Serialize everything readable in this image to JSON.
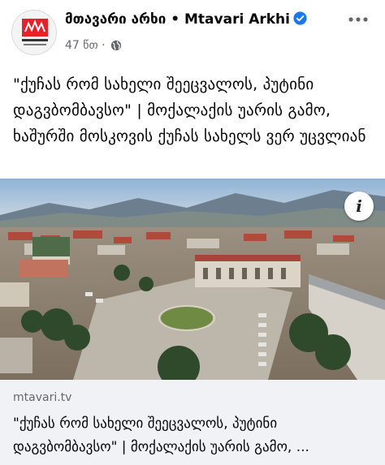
{
  "post": {
    "page_name": "მთავარი არხი • Mtavari Arkhi",
    "time": "47 წთ ·",
    "audience_icon": "globe-icon",
    "text": "\"ქუჩას რომ სახელი შეეცვალოს, პუტინი დაგვბომბავსო\" | მოქალაქის უარის გამო, ხაშურში მოსკოვის ქუჩას სახელს ვერ უცვლიან"
  },
  "link_preview": {
    "domain": "mtavari.tv",
    "title": "\"ქუჩას რომ სახელი შეეცვალოს, პუტინი დაგვბომბავსო\" | მოქალაქის უარის გამო, ..."
  },
  "photo": {
    "info_label": "i"
  },
  "colors": {
    "brand_red": "#e8202a",
    "verified_blue": "#1877f2",
    "secondary_text": "#65676b",
    "preview_bg": "#f0f2f5"
  }
}
